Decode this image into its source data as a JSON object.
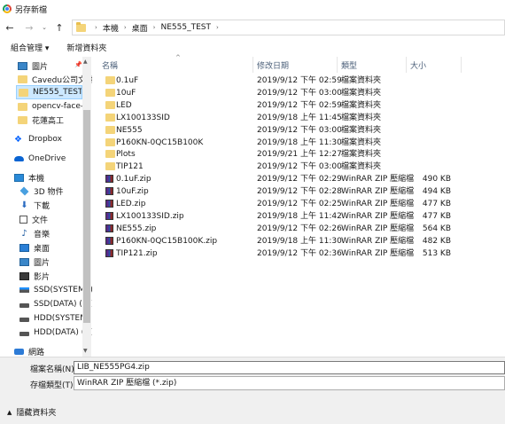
{
  "window": {
    "title": "另存新檔"
  },
  "nav": {
    "back": "←",
    "forward": "→",
    "recent": "⌄",
    "up": "↑",
    "breadcrumb": [
      "本機",
      "桌面",
      "NE555_TEST"
    ],
    "crumb_sep": "›"
  },
  "toolbar": {
    "organize": "組合管理 ▾",
    "new_folder": "新增資料夾"
  },
  "sidebar": {
    "items": [
      {
        "label": "圖片",
        "icon": "picture-icon"
      },
      {
        "label": "Cavedu公司文件",
        "icon": "folder-icon"
      },
      {
        "label": "NE555_TEST",
        "icon": "folder-icon",
        "selected": true
      },
      {
        "label": "opencv-face-lo",
        "icon": "folder-icon"
      },
      {
        "label": "花蓮高工",
        "icon": "folder-icon"
      },
      {
        "label": "Dropbox",
        "icon": "dropbox-icon"
      },
      {
        "label": "OneDrive",
        "icon": "onedrive-icon"
      },
      {
        "label": "本機",
        "icon": "pc-icon"
      },
      {
        "label": "3D 物件",
        "icon": "3d-objects-icon"
      },
      {
        "label": "下載",
        "icon": "download-icon"
      },
      {
        "label": "文件",
        "icon": "documents-icon"
      },
      {
        "label": "音樂",
        "icon": "music-icon"
      },
      {
        "label": "桌面",
        "icon": "desktop-icon"
      },
      {
        "label": "圖片",
        "icon": "picture-icon"
      },
      {
        "label": "影片",
        "icon": "video-icon"
      },
      {
        "label": "SSD(SYSTEM) (",
        "icon": "system-drive-icon"
      },
      {
        "label": "SSD(DATA) (D:)",
        "icon": "drive-icon"
      },
      {
        "label": "HDD(SYSTEM)",
        "icon": "drive-icon"
      },
      {
        "label": "HDD(DATA) (F:)",
        "icon": "drive-icon"
      },
      {
        "label": "網路",
        "icon": "network-icon"
      }
    ],
    "pin": "📌"
  },
  "columns": {
    "name": "名稱",
    "date": "修改日期",
    "type": "類型",
    "size": "大小"
  },
  "files": [
    {
      "name": "0.1uF",
      "date": "2019/9/12 下午 02:59",
      "type": "檔案資料夾",
      "size": "",
      "kind": "folder"
    },
    {
      "name": "10uF",
      "date": "2019/9/12 下午 03:00",
      "type": "檔案資料夾",
      "size": "",
      "kind": "folder"
    },
    {
      "name": "LED",
      "date": "2019/9/12 下午 02:59",
      "type": "檔案資料夾",
      "size": "",
      "kind": "folder"
    },
    {
      "name": "LX100133SID",
      "date": "2019/9/18 上午 11:45",
      "type": "檔案資料夾",
      "size": "",
      "kind": "folder"
    },
    {
      "name": "NE555",
      "date": "2019/9/12 下午 03:00",
      "type": "檔案資料夾",
      "size": "",
      "kind": "folder"
    },
    {
      "name": "P160KN-0QC15B100K",
      "date": "2019/9/18 上午 11:30",
      "type": "檔案資料夾",
      "size": "",
      "kind": "folder"
    },
    {
      "name": "Plots",
      "date": "2019/9/21 上午 12:27",
      "type": "檔案資料夾",
      "size": "",
      "kind": "folder"
    },
    {
      "name": "TIP121",
      "date": "2019/9/12 下午 03:00",
      "type": "檔案資料夾",
      "size": "",
      "kind": "folder"
    },
    {
      "name": "0.1uF.zip",
      "date": "2019/9/12 下午 02:29",
      "type": "WinRAR ZIP 壓縮檔",
      "size": "490 KB",
      "kind": "zip"
    },
    {
      "name": "10uF.zip",
      "date": "2019/9/12 下午 02:28",
      "type": "WinRAR ZIP 壓縮檔",
      "size": "494 KB",
      "kind": "zip"
    },
    {
      "name": "LED.zip",
      "date": "2019/9/12 下午 02:25",
      "type": "WinRAR ZIP 壓縮檔",
      "size": "477 KB",
      "kind": "zip"
    },
    {
      "name": "LX100133SID.zip",
      "date": "2019/9/18 上午 11:42",
      "type": "WinRAR ZIP 壓縮檔",
      "size": "477 KB",
      "kind": "zip"
    },
    {
      "name": "NE555.zip",
      "date": "2019/9/12 下午 02:26",
      "type": "WinRAR ZIP 壓縮檔",
      "size": "564 KB",
      "kind": "zip"
    },
    {
      "name": "P160KN-0QC15B100K.zip",
      "date": "2019/9/18 上午 11:30",
      "type": "WinRAR ZIP 壓縮檔",
      "size": "482 KB",
      "kind": "zip"
    },
    {
      "name": "TIP121.zip",
      "date": "2019/9/12 下午 02:36",
      "type": "WinRAR ZIP 壓縮檔",
      "size": "513 KB",
      "kind": "zip"
    }
  ],
  "form": {
    "filename_label": "檔案名稱(N):",
    "filename_value": "LIB_NE555PG4.zip",
    "filetype_label": "存檔類型(T):",
    "filetype_value": "WinRAR ZIP 壓縮檔 (*.zip)",
    "hide_folders": "隱藏資料夾"
  }
}
